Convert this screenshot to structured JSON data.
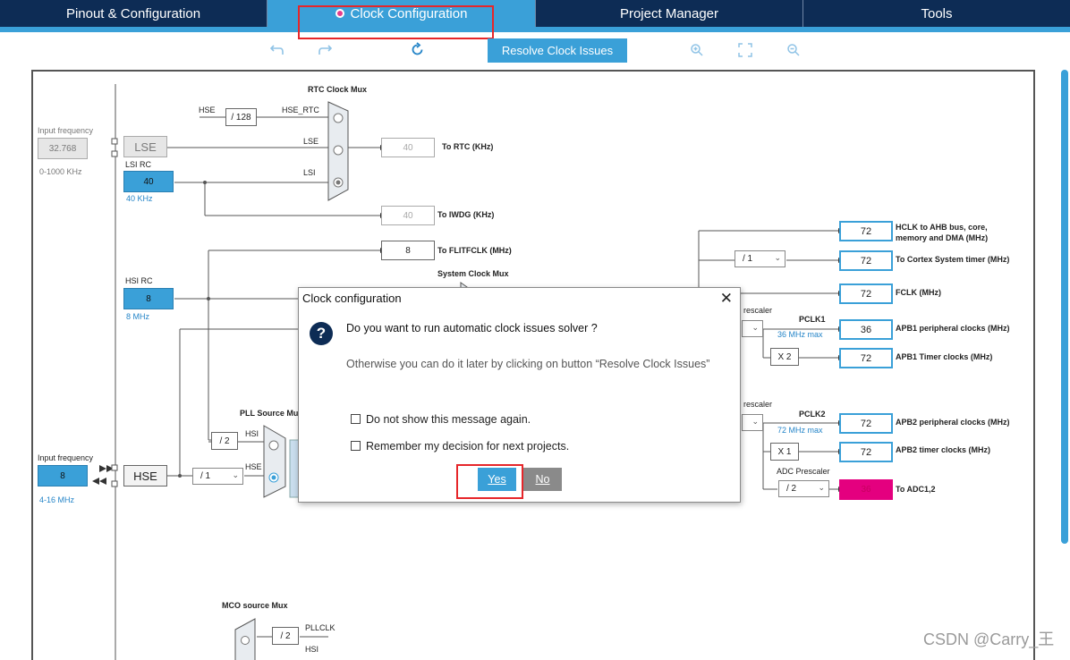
{
  "tabs": [
    {
      "label": "Pinout & Configuration"
    },
    {
      "label": "Clock Configuration"
    },
    {
      "label": "Project Manager"
    },
    {
      "label": "Tools"
    }
  ],
  "toolbar": {
    "resolve_label": "Resolve Clock Issues"
  },
  "diagram": {
    "rtc_mux_label": "RTC Clock Mux",
    "hse_label": "HSE",
    "div128": "/ 128",
    "hse_rtc": "HSE_RTC",
    "input_freq_label": "Input frequency",
    "lse_freq": "32.768",
    "lse_range": "0-1000 KHz",
    "lse_label": "LSE",
    "lse_line": "LSE",
    "lsi_rc_label": "LSI RC",
    "lsi_val": "40",
    "lsi_khz": "40 KHz",
    "lsi_line": "LSI",
    "rtc_val": "40",
    "rtc_label": "To RTC (KHz)",
    "iwdg_val": "40",
    "iwdg_label": "To IWDG (KHz)",
    "flit_val": "8",
    "flit_label": "To FLITFCLK (MHz)",
    "sys_mux_label": "System Clock Mux",
    "hsi_rc_label": "HSI RC",
    "hsi_val": "8",
    "hsi_mhz": "8 MHz",
    "pll_src_label": "PLL Source Mu",
    "pll_hsi": "HSI",
    "pll_hse": "HSE",
    "pll_div2": "/ 2",
    "hse_input_label": "Input frequency",
    "hse_val": "8",
    "hse_range": "4-16 MHz",
    "hse_box": "HSE",
    "hse_div": "/ 1",
    "mco_label": "MCO source Mux",
    "mco_div": "/ 2",
    "mco_pllclk": "PLLCLK",
    "mco_hsi": "HSI",
    "hclk_val": "72",
    "hclk_label": "HCLK to AHB bus, core,",
    "hclk_label2": "memory and DMA (MHz)",
    "cortex_div": "/ 1",
    "cortex_val": "72",
    "cortex_label": "To Cortex System timer (MHz)",
    "fclk_val": "72",
    "fclk_label": "FCLK (MHz)",
    "apb1_presc": "rescaler",
    "pclk1": "PCLK1",
    "pclk1_max": "36 MHz max",
    "apb1_val": "36",
    "apb1_label": "APB1 peripheral clocks (MHz)",
    "apb1_mul": "X 2",
    "apb1t_val": "72",
    "apb1t_label": "APB1 Timer clocks (MHz)",
    "apb2_presc": "rescaler",
    "pclk2": "PCLK2",
    "pclk2_max": "72 MHz max",
    "apb2_val": "72",
    "apb2_label": "APB2 peripheral clocks (MHz)",
    "apb2_mul": "X 1",
    "apb2t_val": "72",
    "apb2t_label": "APB2 timer clocks (MHz)",
    "adc_presc": "ADC Prescaler",
    "adc_div": "/ 2",
    "adc_val": "36",
    "adc_label": "To ADC1,2"
  },
  "dialog": {
    "title": "Clock configuration",
    "question": "Do you want to run automatic clock issues solver ?",
    "hint": "Otherwise you can do it later by clicking on button “Resolve Clock Issues”",
    "cb1": "Do not show this message again.",
    "cb2": "Remember my decision for next projects.",
    "yes": "Yes",
    "no": "No"
  },
  "watermark": "CSDN @Carry_王",
  "colors": {
    "tab_bg": "#0d2c55",
    "accent": "#3aa0d8",
    "highlight": "#e6262a",
    "adc_fill": "#e4007f"
  }
}
